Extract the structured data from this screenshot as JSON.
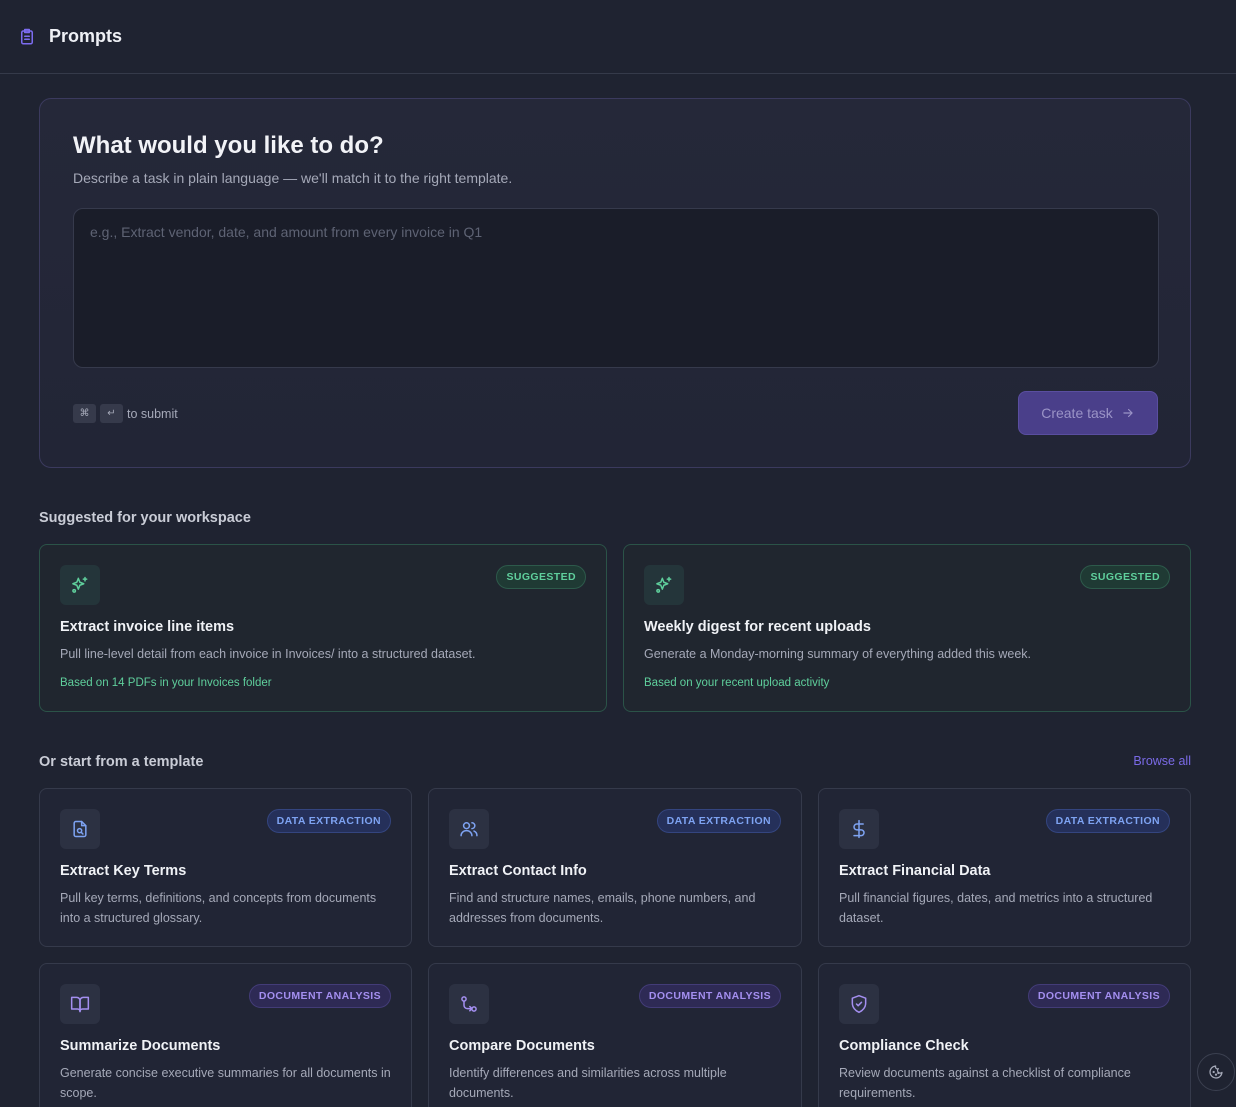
{
  "header": {
    "title": "Prompts",
    "icon": "clipboard-list-icon"
  },
  "hero": {
    "heading": "What would you like to do?",
    "subheading": "Describe a task in plain language — we'll match it to the right template.",
    "input_placeholder": "e.g., Extract vendor, date, and amount from every invoice in Q1",
    "input_value": "",
    "shortcut_keys": [
      "⌘",
      "↵"
    ],
    "shortcut_label": "to submit",
    "submit_label": "Create task"
  },
  "suggested": {
    "section_title": "Suggested for your workspace",
    "items": [
      {
        "badge": "SUGGESTED",
        "icon": "sparkles-icon",
        "title": "Extract invoice line items",
        "description": "Pull line-level detail from each invoice in Invoices/ into a structured dataset.",
        "note": "Based on 14 PDFs in your Invoices folder"
      },
      {
        "badge": "SUGGESTED",
        "icon": "sparkles-icon",
        "title": "Weekly digest for recent uploads",
        "description": "Generate a Monday-morning summary of everything added this week.",
        "note": "Based on your recent upload activity"
      }
    ]
  },
  "templates": {
    "section_title": "Or start from a template",
    "browse_all_label": "Browse all",
    "items": [
      {
        "badge": "DATA EXTRACTION",
        "icon": "file-search-icon",
        "title": "Extract Key Terms",
        "description": "Pull key terms, definitions, and concepts from documents into a structured glossary."
      },
      {
        "badge": "DATA EXTRACTION",
        "icon": "users-icon",
        "title": "Extract Contact Info",
        "description": "Find and structure names, emails, phone numbers, and addresses from documents."
      },
      {
        "badge": "DATA EXTRACTION",
        "icon": "dollar-icon",
        "title": "Extract Financial Data",
        "description": "Pull financial figures, dates, and metrics into a structured dataset."
      },
      {
        "badge": "DOCUMENT ANALYSIS",
        "icon": "book-open-icon",
        "title": "Summarize Documents",
        "description": "Generate concise executive summaries for all documents in scope."
      },
      {
        "badge": "DOCUMENT ANALYSIS",
        "icon": "git-compare-icon",
        "title": "Compare Documents",
        "description": "Identify differences and similarities across multiple documents."
      },
      {
        "badge": "DOCUMENT ANALYSIS",
        "icon": "shield-check-icon",
        "title": "Compliance Check",
        "description": "Review documents against a checklist of compliance requirements."
      }
    ]
  },
  "floating_button": {
    "icon": "cookie-icon"
  },
  "colors": {
    "background": "#1f2331",
    "accent_purple": "#7a6ae6",
    "suggested_green": "#5fcf9c",
    "data_extraction_blue": "#7ea3f2",
    "document_analysis_purple": "#a48ff0"
  }
}
